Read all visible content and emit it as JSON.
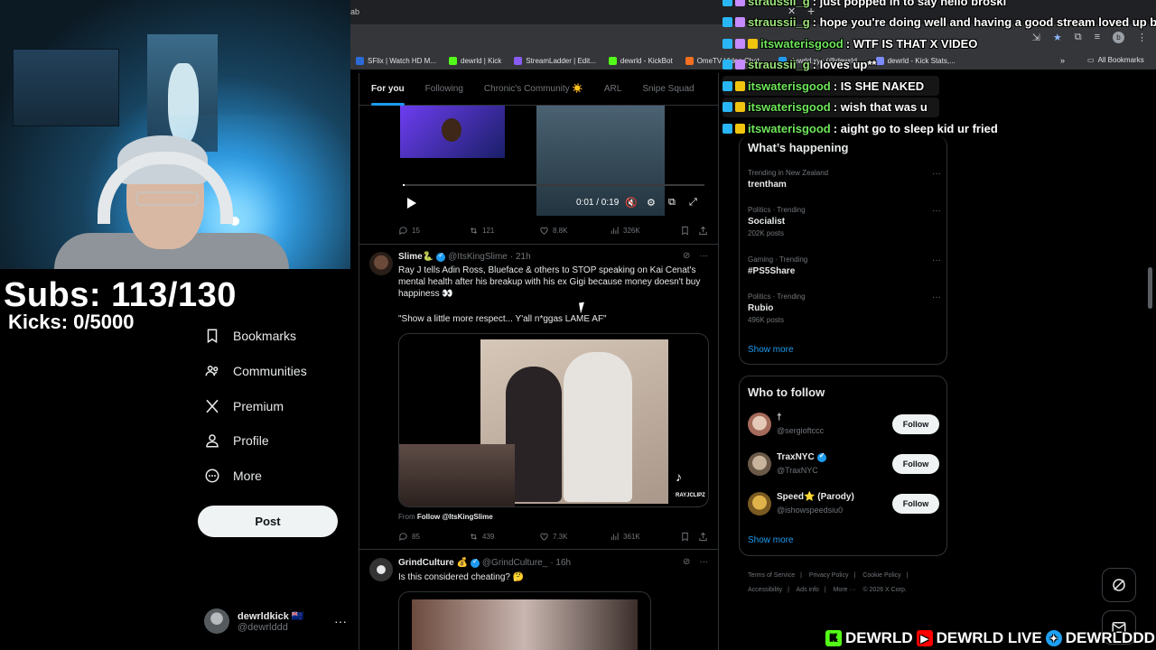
{
  "stream": {
    "subs": "Subs: 113/130",
    "kicks": "Kicks: 0/5000",
    "socials": [
      "DEWRLD",
      "DEWRLD LIVE",
      "DEWRLDDD"
    ]
  },
  "browser": {
    "tab_text": "ab",
    "bookmarks": [
      {
        "label": "SFlix | Watch HD M...",
        "color": "#2b6bd6"
      },
      {
        "label": "dewrld | Kick",
        "color": "#53fc18"
      },
      {
        "label": "StreamLadder | Edit...",
        "color": "#8a5cf6"
      },
      {
        "label": "dewrld - KickBot",
        "color": "#53fc18"
      },
      {
        "label": "OmeTV Video Chat...",
        "color": "#f36f21"
      },
      {
        "label": "dewrld.xyz (@dewrld...",
        "color": "#1d9bf0"
      },
      {
        "label": "dewrld - Kick Stats,...",
        "color": "#7c8cff"
      }
    ],
    "all_bookmarks": "All Bookmarks"
  },
  "nav": {
    "items": [
      {
        "label": "Bookmarks",
        "icon": "bookmark-icon"
      },
      {
        "label": "Communities",
        "icon": "communities-icon"
      },
      {
        "label": "Premium",
        "icon": "x-logo-icon"
      },
      {
        "label": "Profile",
        "icon": "profile-icon"
      },
      {
        "label": "More",
        "icon": "more-circle-icon"
      }
    ],
    "post_label": "Post",
    "account": {
      "name": "dewrldkick",
      "handle": "@dewrlddd"
    }
  },
  "feed": {
    "tabs": [
      "For you",
      "Following",
      "Chronic's Community ☀️",
      "ARL",
      "Snipe Squad"
    ],
    "active_tab": 0,
    "video": {
      "time": "0:01 / 0:19",
      "progress": 0.005
    },
    "tweet0_actions": {
      "replies": "15",
      "reposts": "121",
      "likes": "8.8K",
      "views": "326K"
    },
    "tweet1": {
      "name": "Slime🐍",
      "handle": "@ItsKingSlime",
      "time": "· 21h",
      "text": "Ray J tells Adin Ross, Blueface & others to STOP speaking on Kai Cenat's mental health after his breakup with his ex Gigi because money doesn't buy happiness 👀",
      "quote": "\"Show a little more respect... Y'all n*ggas LAME AF\"",
      "watermark": "RAYJCLIPZ",
      "from_prefix": "From",
      "from_link": "Follow @ItsKingSlime",
      "actions": {
        "replies": "85",
        "reposts": "439",
        "likes": "7.3K",
        "views": "361K"
      }
    },
    "tweet2": {
      "name": "GrindCulture 💰",
      "handle": "@GrindCulture_",
      "time": "· 16h",
      "text": "Is this considered cheating? 🤔"
    }
  },
  "trends": {
    "title": "What’s happening",
    "items": [
      {
        "context": "Trending in New Zealand",
        "topic": "trentham",
        "count": ""
      },
      {
        "context": "Politics · Trending",
        "topic": "Socialist",
        "count": "202K posts"
      },
      {
        "context": "Gaming · Trending",
        "topic": "#PS5Share",
        "count": ""
      },
      {
        "context": "Politics · Trending",
        "topic": "Rubio",
        "count": "496K posts"
      }
    ],
    "show_more": "Show more"
  },
  "who_to_follow": {
    "title": "Who to follow",
    "items": [
      {
        "name": "†",
        "handle": "@sergioftccc",
        "verified": false,
        "button": "Follow"
      },
      {
        "name": "TraxNYC",
        "handle": "@TraxNYC",
        "verified": true,
        "button": "Follow"
      },
      {
        "name": "Speed⭐ (Parody)",
        "handle": "@ishowspeedsiu0",
        "verified": false,
        "button": "Follow"
      }
    ],
    "show_more": "Show more"
  },
  "footer": {
    "links": [
      "Terms of Service",
      "Privacy Policy",
      "Cookie Policy",
      "Accessibility",
      "Ads info",
      "More ···",
      "© 2026 X Corp."
    ]
  },
  "chat": [
    {
      "user": "straussii_g",
      "message": ": just popped in to say hello broski"
    },
    {
      "user": "straussii_g",
      "message": ": hope you're doing well and having a good stream loved up broski"
    },
    {
      "user": "itswaterisgood",
      "message": ": WTF IS THAT X VIDEO"
    },
    {
      "user": "straussii_g",
      "message": ": loves up**"
    },
    {
      "user": "itswaterisgood",
      "message": ": IS SHE NAKED"
    },
    {
      "user": "itswaterisgood",
      "message": ": wish that was u"
    },
    {
      "user": "itswaterisgood",
      "message": ": aight go to sleep kid ur fried"
    }
  ]
}
